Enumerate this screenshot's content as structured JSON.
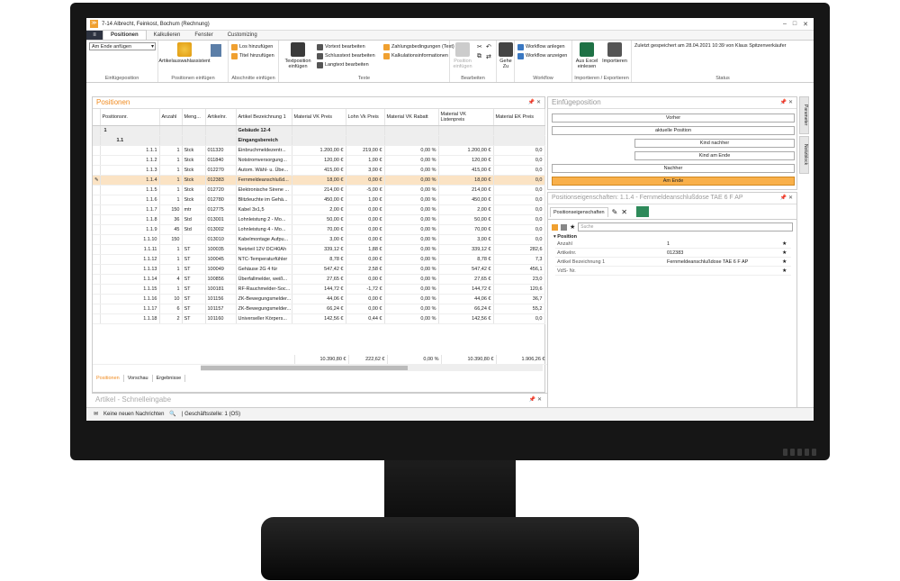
{
  "window": {
    "title": "7-14 Albrecht, Feinkost, Bochum (Rechnung)",
    "controls": [
      "–",
      "□",
      "✕"
    ]
  },
  "menu": {
    "file_icon": "≡",
    "tabs": [
      "Positionen",
      "Kalkulieren",
      "Fenster",
      "Customizing"
    ],
    "active": "Positionen"
  },
  "ribbon": {
    "einfuege": {
      "combo": "Am Ende anfügen",
      "label": "Einfügeposition"
    },
    "positionen_einfuegen": {
      "assistant": "Artikelauswahlassistent",
      "label": "Positionen einfügen"
    },
    "abschnitte": {
      "items": [
        "Los hinzufügen",
        "Titel hinzufügen"
      ],
      "label": "Abschnitte einfügen"
    },
    "texte": {
      "big": "Textposition einfügen",
      "items": [
        "Vortext bearbeiten",
        "Schlusstext bearbeiten",
        "Langtext bearbeiten",
        "Zahlungsbedingungen (Text)",
        "Kalkulationsinformationen"
      ],
      "label": "Texte"
    },
    "bearbeiten": {
      "big": "Position einfügen",
      "label": "Bearbeiten"
    },
    "gehe": {
      "big": "Gehe Zu",
      "label": ""
    },
    "workflow": {
      "items": [
        "Workflow anlegen",
        "Workflow anzeigen"
      ],
      "label": "Workflow"
    },
    "import": {
      "items": [
        "Aus Excel einlesen",
        "Importieren"
      ],
      "label": "Importieren / Exportieren"
    },
    "status": {
      "text": "Zuletzt gespeichert am 28.04.2021 10:39 von Klaus Spitzenverkäufer",
      "label": "Status"
    }
  },
  "positions_panel": {
    "title": "Positionen",
    "columns": [
      "Positionsnr.",
      "Anzahl",
      "Meng...",
      "Artikelnr.",
      "Artikel Bezeichnung 1",
      "Material VK Preis",
      "Lohn Vk Preis",
      "Material VK Rabatt",
      "Material VK Listenpreis",
      "Material EK Preis"
    ],
    "rows": [
      {
        "pos": "1",
        "anzahl": "",
        "me": "",
        "nr": "",
        "bez": "Gebäude 12-4",
        "mvk": "",
        "lvk": "",
        "rab": "",
        "list": "",
        "ek": "",
        "type": "grp"
      },
      {
        "pos": "1.1",
        "anzahl": "",
        "me": "",
        "nr": "",
        "bez": "Eingangsbereich",
        "mvk": "",
        "lvk": "",
        "rab": "",
        "list": "",
        "ek": "",
        "type": "grp"
      },
      {
        "pos": "1.1.1",
        "anzahl": "1",
        "me": "Stck",
        "nr": "011320",
        "bez": "Einbruchmeldezentr...",
        "mvk": "1.200,00 €",
        "lvk": "219,00 €",
        "rab": "0,00 %",
        "list": "1.200,00 €",
        "ek": "0,0",
        "type": ""
      },
      {
        "pos": "1.1.2",
        "anzahl": "1",
        "me": "Stck",
        "nr": "011840",
        "bez": "Notstromversorgung...",
        "mvk": "120,00 €",
        "lvk": "1,00 €",
        "rab": "0,00 %",
        "list": "120,00 €",
        "ek": "0,0",
        "type": ""
      },
      {
        "pos": "1.1.3",
        "anzahl": "1",
        "me": "Stck",
        "nr": "012270",
        "bez": "Autom. Wähl- u. Übe...",
        "mvk": "415,00 €",
        "lvk": "3,00 €",
        "rab": "0,00 %",
        "list": "415,00 €",
        "ek": "0,0",
        "type": ""
      },
      {
        "pos": "1.1.4",
        "anzahl": "1",
        "me": "Stck",
        "nr": "012383",
        "bez": "Fernmeldeanschlußd...",
        "mvk": "18,00 €",
        "lvk": "0,00 €",
        "rab": "0,00 %",
        "list": "18,00 €",
        "ek": "0,0",
        "type": "sel"
      },
      {
        "pos": "1.1.5",
        "anzahl": "1",
        "me": "Stck",
        "nr": "012720",
        "bez": "Elektronische Sirene ...",
        "mvk": "214,00 €",
        "lvk": "-5,00 €",
        "rab": "0,00 %",
        "list": "214,00 €",
        "ek": "0,0",
        "type": ""
      },
      {
        "pos": "1.1.6",
        "anzahl": "1",
        "me": "Stck",
        "nr": "012780",
        "bez": "Blitzleuchte im Gehä...",
        "mvk": "450,00 €",
        "lvk": "1,00 €",
        "rab": "0,00 %",
        "list": "450,00 €",
        "ek": "0,0",
        "type": ""
      },
      {
        "pos": "1.1.7",
        "anzahl": "150",
        "me": "mtr",
        "nr": "012775",
        "bez": "Kabel 3x1,5",
        "mvk": "2,00 €",
        "lvk": "0,00 €",
        "rab": "0,00 %",
        "list": "2,00 €",
        "ek": "0,0",
        "type": ""
      },
      {
        "pos": "1.1.8",
        "anzahl": "36",
        "me": "Std",
        "nr": "013001",
        "bez": "Lohnleistung 2 - Mo...",
        "mvk": "50,00 €",
        "lvk": "0,00 €",
        "rab": "0,00 %",
        "list": "50,00 €",
        "ek": "0,0",
        "type": ""
      },
      {
        "pos": "1.1.9",
        "anzahl": "45",
        "me": "Std",
        "nr": "013002",
        "bez": "Lohnleistung 4 - Mo...",
        "mvk": "70,00 €",
        "lvk": "0,00 €",
        "rab": "0,00 %",
        "list": "70,00 €",
        "ek": "0,0",
        "type": ""
      },
      {
        "pos": "1.1.10",
        "anzahl": "150",
        "me": "",
        "nr": "013010",
        "bez": "Kabelmontage Aufpu...",
        "mvk": "3,00 €",
        "lvk": "0,00 €",
        "rab": "0,00 %",
        "list": "3,00 €",
        "ek": "0,0",
        "type": ""
      },
      {
        "pos": "1.1.11",
        "anzahl": "1",
        "me": "ST",
        "nr": "100035",
        "bez": "Netzteil 12V DC/40Ah",
        "mvk": "339,12 €",
        "lvk": "1,88 €",
        "rab": "0,00 %",
        "list": "339,12 €",
        "ek": "282,6",
        "type": ""
      },
      {
        "pos": "1.1.12",
        "anzahl": "1",
        "me": "ST",
        "nr": "100045",
        "bez": "NTC-Temperaturfühler",
        "mvk": "8,78 €",
        "lvk": "0,00 €",
        "rab": "0,00 %",
        "list": "8,78 €",
        "ek": "7,3",
        "type": ""
      },
      {
        "pos": "1.1.13",
        "anzahl": "1",
        "me": "ST",
        "nr": "100049",
        "bez": "Gehäuse 2G 4 für",
        "mvk": "547,42 €",
        "lvk": "2,58 €",
        "rab": "0,00 %",
        "list": "547,42 €",
        "ek": "456,1",
        "type": ""
      },
      {
        "pos": "1.1.14",
        "anzahl": "4",
        "me": "ST",
        "nr": "100856",
        "bez": "Überfallmelder, weiß...",
        "mvk": "27,65 €",
        "lvk": "0,00 €",
        "rab": "0,00 %",
        "list": "27,65 €",
        "ek": "23,0",
        "type": ""
      },
      {
        "pos": "1.1.15",
        "anzahl": "1",
        "me": "ST",
        "nr": "100181",
        "bez": "RF-Rauchmelder-Soc...",
        "mvk": "144,72 €",
        "lvk": "-1,72 €",
        "rab": "0,00 %",
        "list": "144,72 €",
        "ek": "120,6",
        "type": ""
      },
      {
        "pos": "1.1.16",
        "anzahl": "10",
        "me": "ST",
        "nr": "101156",
        "bez": "ZK-Bewegungsmelder...",
        "mvk": "44,06 €",
        "lvk": "0,00 €",
        "rab": "0,00 %",
        "list": "44,06 €",
        "ek": "36,7",
        "type": ""
      },
      {
        "pos": "1.1.17",
        "anzahl": "6",
        "me": "ST",
        "nr": "101157",
        "bez": "ZK-Bewegungsmelder...",
        "mvk": "66,24 €",
        "lvk": "0,00 €",
        "rab": "0,00 %",
        "list": "66,24 €",
        "ek": "55,2",
        "type": ""
      },
      {
        "pos": "1.1.18",
        "anzahl": "2",
        "me": "ST",
        "nr": "101160",
        "bez": "Universeller Körpers...",
        "mvk": "142,56 €",
        "lvk": "0,44 €",
        "rab": "0,00 %",
        "list": "142,56 €",
        "ek": "0,0",
        "type": ""
      }
    ],
    "totals": {
      "mvk": "10.390,80 €",
      "lvk": "222,62 €",
      "rab": "0,00 %",
      "list": "10.390,80 €",
      "ek": "1.906,26 €"
    },
    "bottom_tabs": [
      "Positionen",
      "Vorschau",
      "Ergebnisse"
    ]
  },
  "artikel_panel": {
    "title": "Artikel - Schnelleingabe"
  },
  "einfuegeposition_panel": {
    "title": "Einfügeposition",
    "buttons": [
      "Vorher",
      "aktuelle Position",
      "Kind nachher",
      "Kind am Ende",
      "Nachher",
      "Am Ende"
    ]
  },
  "props_panel": {
    "title": "Positionseigenschaften: 1.1.4 - Fernmeldeanschlußdose TAE 6 F AP",
    "tab": "Positionseigenschaften",
    "search_placeholder": "Suche",
    "section": "Position",
    "rows": [
      {
        "k": "Anzahl",
        "v": "1"
      },
      {
        "k": "Artikelnr.",
        "v": "012383"
      },
      {
        "k": "Artikel Bezeichnung 1",
        "v": "Fernmeldeanschlußdose TAE 6 F AP"
      },
      {
        "k": "VdS- Nr.",
        "v": ""
      }
    ]
  },
  "side_tabs": [
    "Parameter",
    "Notizblock"
  ],
  "statusbar": {
    "messages": "Keine neuen Nachrichten",
    "branch": "| Geschäftsstelle: 1 (OS)"
  },
  "colors": {
    "accent": "#f08a1e",
    "selected": "#fbe3c4",
    "button_orange": "#f9b04a"
  }
}
